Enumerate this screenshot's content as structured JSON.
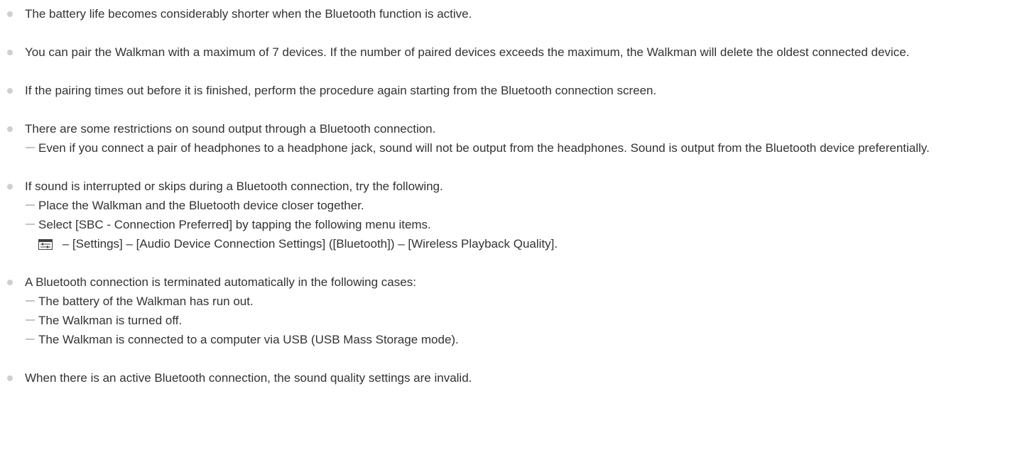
{
  "notes": [
    {
      "text": "The battery life becomes considerably shorter when the Bluetooth function is active."
    },
    {
      "text": "You can pair the Walkman with a maximum of 7 devices. If the number of paired devices exceeds the maximum, the Walkman will delete the oldest connected device."
    },
    {
      "text": "If the pairing times out before it is finished, perform the procedure again starting from the Bluetooth connection screen."
    },
    {
      "text": "There are some restrictions on sound output through a Bluetooth connection.",
      "sub": [
        "Even if you connect a pair of headphones to a headphone jack, sound will not be output from the headphones. Sound is output from the Bluetooth device preferentially."
      ]
    },
    {
      "text": "If sound is interrupted or skips during a Bluetooth connection, try the following.",
      "sub": [
        "Place the Walkman and the Bluetooth device closer together.",
        "Select [SBC - Connection Preferred] by tapping the following menu items."
      ],
      "menu_path": "– [Settings] – [Audio Device Connection Settings] ([Bluetooth]) – [Wireless Playback Quality].",
      "menu_icon": "options-menu-icon"
    },
    {
      "text": "A Bluetooth connection is terminated automatically in the following cases:",
      "sub": [
        "The battery of the Walkman has run out.",
        "The Walkman is turned off.",
        "The Walkman is connected to a computer via USB (USB Mass Storage mode)."
      ]
    },
    {
      "text": "When there is an active Bluetooth connection, the sound quality settings are invalid."
    }
  ],
  "colors": {
    "text": "#333333",
    "bullet": "#cfcfcf",
    "dash": "#c4c4c4",
    "icon_dark": "#404040"
  }
}
